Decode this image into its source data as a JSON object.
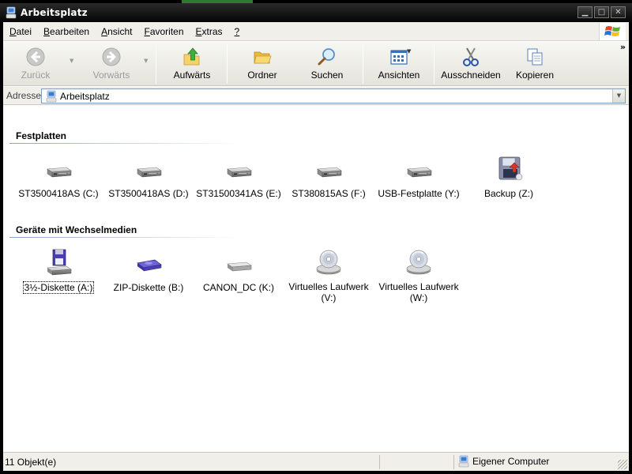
{
  "window": {
    "title": "Arbeitsplatz"
  },
  "menubar": [
    {
      "pre": "",
      "u": "D",
      "post": "atei"
    },
    {
      "pre": "",
      "u": "B",
      "post": "earbeiten"
    },
    {
      "pre": "",
      "u": "A",
      "post": "nsicht"
    },
    {
      "pre": "",
      "u": "F",
      "post": "avoriten"
    },
    {
      "pre": "",
      "u": "E",
      "post": "xtras"
    },
    {
      "pre": "",
      "u": "?",
      "post": ""
    }
  ],
  "toolbar": {
    "back": "Zurück",
    "forward": "Vorwärts",
    "up": "Aufwärts",
    "folders": "Ordner",
    "search": "Suchen",
    "views": "Ansichten",
    "cut": "Ausschneiden",
    "copy": "Kopieren"
  },
  "address": {
    "label": "Adresse",
    "value": "Arbeitsplatz"
  },
  "groups": {
    "harddisks": {
      "title": "Festplatten",
      "items": [
        {
          "label": "ST3500418AS (C:)",
          "icon": "hard-drive-icon"
        },
        {
          "label": "ST3500418AS (D:)",
          "icon": "hard-drive-icon"
        },
        {
          "label": "ST31500341AS (E:)",
          "icon": "hard-drive-icon"
        },
        {
          "label": "ST380815AS (F:)",
          "icon": "hard-drive-icon"
        },
        {
          "label": "USB-Festplatte (Y:)",
          "icon": "hard-drive-icon"
        },
        {
          "label": "Backup (Z:)",
          "icon": "backup-drive-icon"
        }
      ]
    },
    "removable": {
      "title": "Geräte mit Wechselmedien",
      "items": [
        {
          "label": "3½-Diskette (A:)",
          "icon": "floppy-drive-icon"
        },
        {
          "label": "ZIP-Diskette (B:)",
          "icon": "zip-drive-icon"
        },
        {
          "label": "CANON_DC (K:)",
          "icon": "removable-drive-icon"
        },
        {
          "label1": "Virtuelles Laufwerk",
          "label2": "(V:)",
          "icon": "cd-drive-icon"
        },
        {
          "label1": "Virtuelles Laufwerk",
          "label2": "(W:)",
          "icon": "cd-drive-icon"
        }
      ]
    }
  },
  "status": {
    "count": "11 Objekt(e)",
    "zone": "Eigener Computer"
  },
  "colors": {
    "titlebar": "#0a0a0a",
    "toolbar_bg": "#ecebe5",
    "group_line": "#8ea3c7"
  }
}
